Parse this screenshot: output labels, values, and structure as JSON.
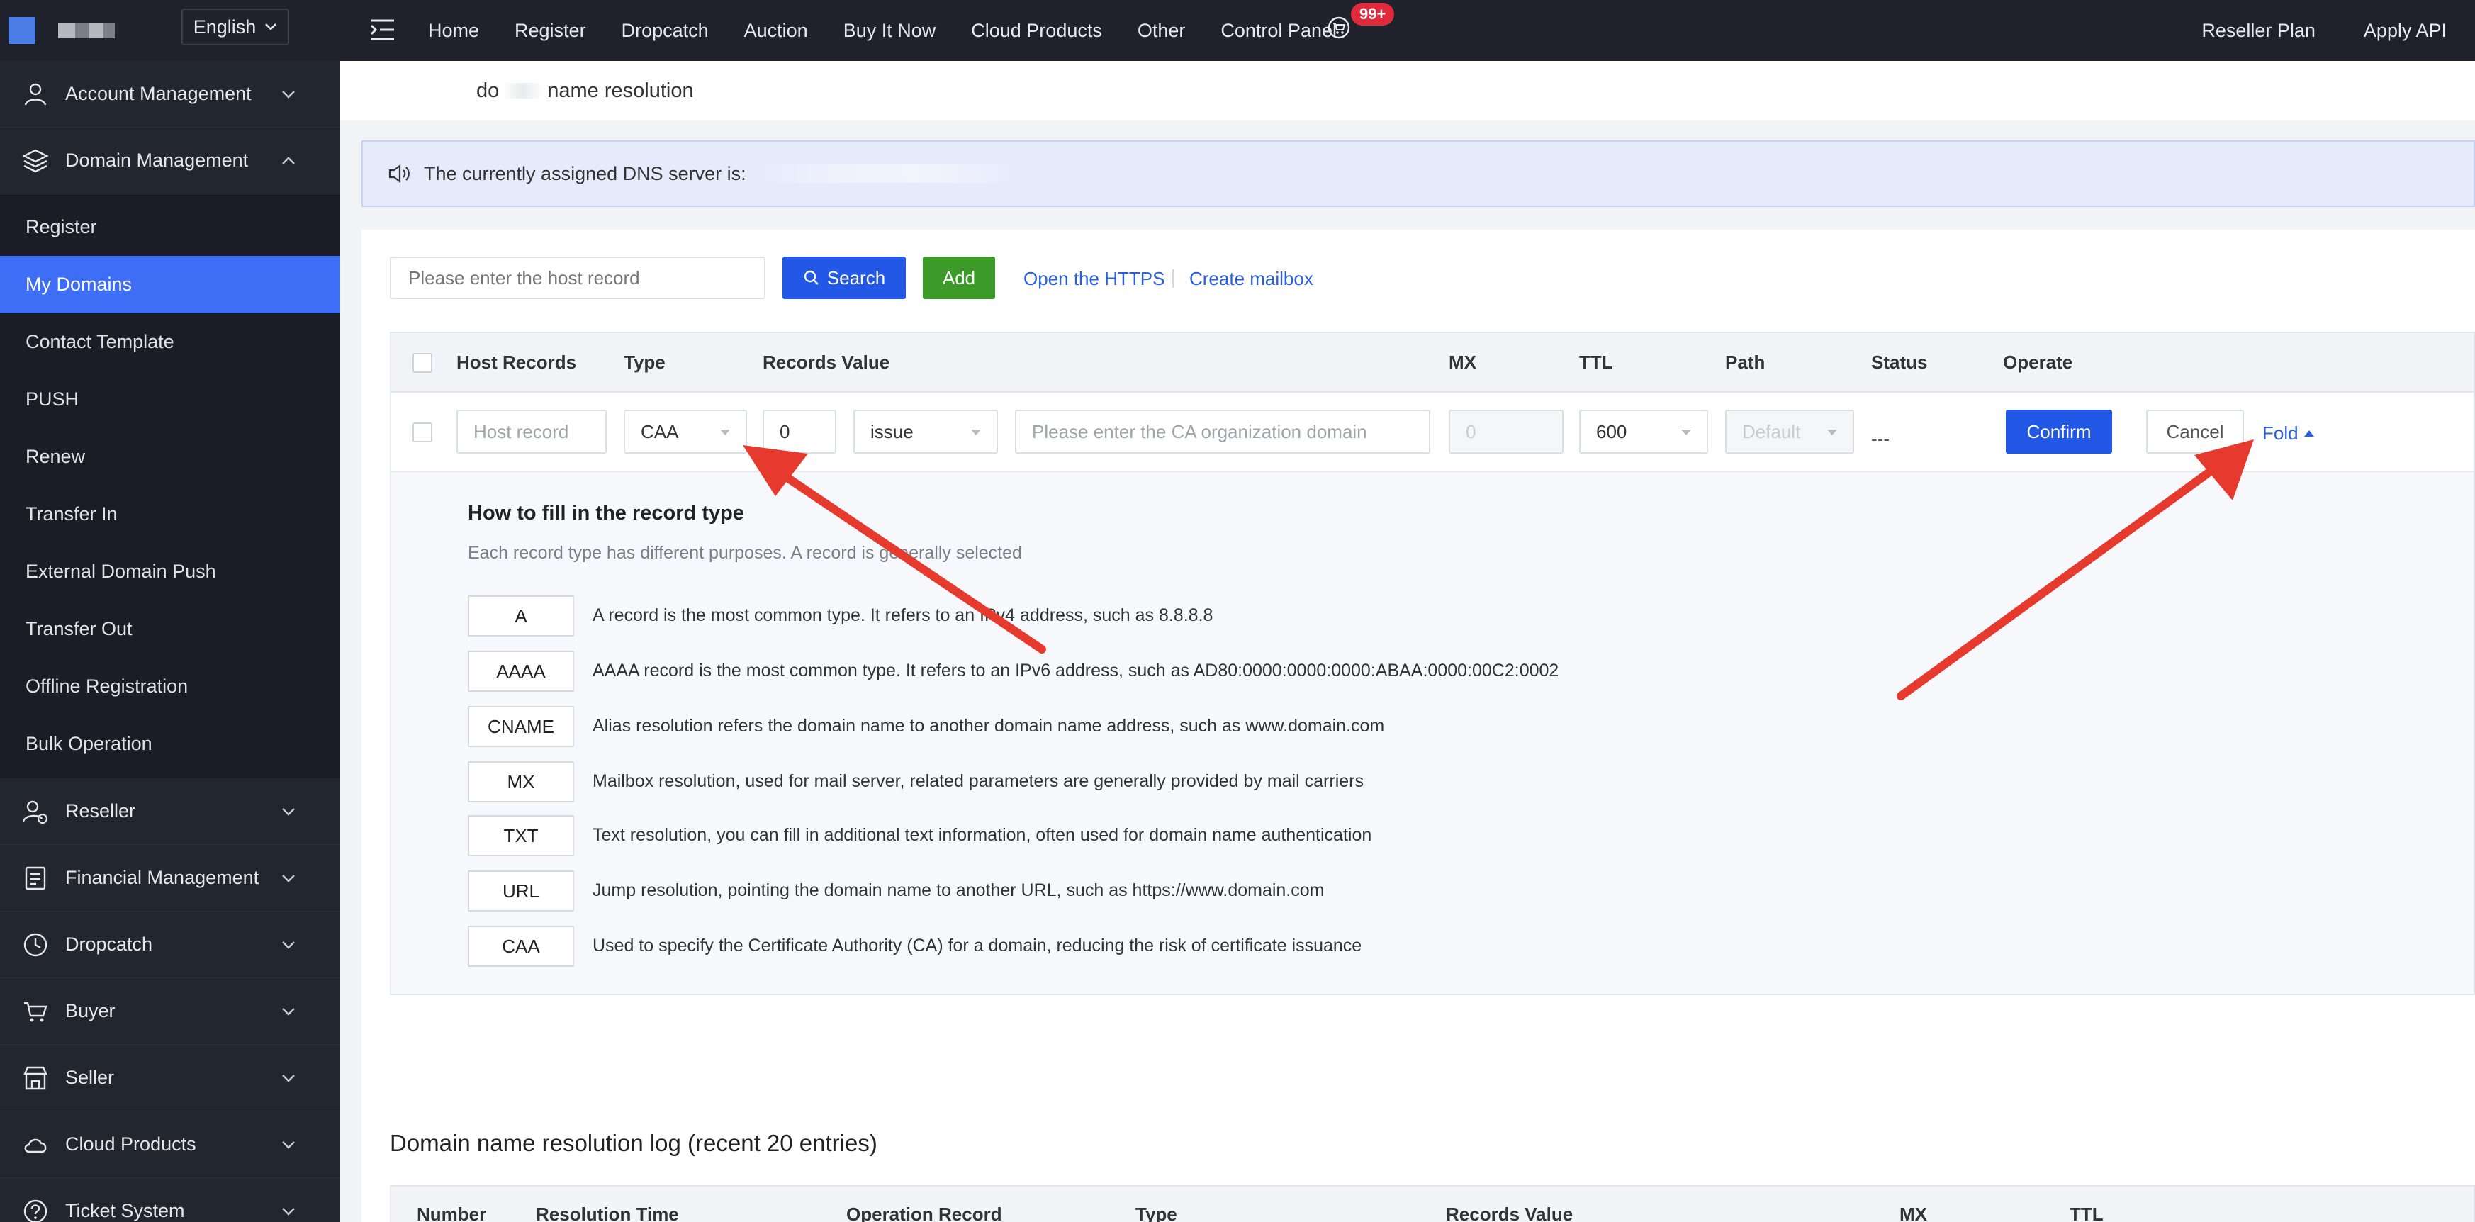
{
  "topbar": {
    "language": "English",
    "nav": [
      "Home",
      "Register",
      "Dropcatch",
      "Auction",
      "Buy It Now",
      "Cloud Products",
      "Other",
      "Control Panel"
    ],
    "cart_badge": "99+",
    "right_links": [
      "Reseller Plan",
      "Apply API"
    ]
  },
  "sidebar": {
    "account": "Account Management",
    "domain": "Domain Management",
    "domain_items": [
      "Register",
      "My Domains",
      "Contact Template",
      "PUSH",
      "Renew",
      "Transfer In",
      "External Domain Push",
      "Transfer Out",
      "Offline Registration",
      "Bulk Operation"
    ],
    "groups": [
      "Reseller",
      "Financial Management",
      "Dropcatch",
      "Buyer",
      "Seller",
      "Cloud Products",
      "Ticket System"
    ]
  },
  "page": {
    "breadcrumb_a": "do",
    "breadcrumb_b": "name resolution",
    "dns_notice": "The currently assigned DNS server is:"
  },
  "toolbar": {
    "search_placeholder": "Please enter the host record",
    "search_label": "Search",
    "add_label": "Add",
    "https_link": "Open the HTTPS",
    "mailbox_link": "Create mailbox"
  },
  "table": {
    "headers": {
      "host": "Host Records",
      "type": "Type",
      "value": "Records Value",
      "mx": "MX",
      "ttl": "TTL",
      "path": "Path",
      "status": "Status",
      "operate": "Operate"
    },
    "edit": {
      "host_placeholder": "Host record",
      "type": "CAA",
      "flag": "0",
      "tag": "issue",
      "value_placeholder": "Please enter the CA organization domain",
      "mx": "0",
      "ttl": "600",
      "path": "Default",
      "status": "---",
      "confirm": "Confirm",
      "cancel": "Cancel",
      "fold": "Fold"
    }
  },
  "help": {
    "title": "How to fill in the record type",
    "subtitle": "Each record type has different purposes. A record is generally selected",
    "types": [
      {
        "tag": "A",
        "desc": "A record is the most common type. It refers to an IPv4 address, such as 8.8.8.8"
      },
      {
        "tag": "AAAA",
        "desc": "AAAA record is the most common type. It refers to an IPv6 address, such as AD80:0000:0000:0000:ABAA:0000:00C2:0002"
      },
      {
        "tag": "CNAME",
        "desc": "Alias resolution refers the domain name to another domain name address, such as www.domain.com"
      },
      {
        "tag": "MX",
        "desc": "Mailbox resolution, used for mail server, related parameters are generally provided by mail carriers"
      },
      {
        "tag": "TXT",
        "desc": "Text resolution, you can fill in additional text information, often used for domain name authentication"
      },
      {
        "tag": "URL",
        "desc": "Jump resolution, pointing the domain name to another URL, such as https://www.domain.com"
      },
      {
        "tag": "CAA",
        "desc": "Used to specify the Certificate Authority (CA) for a domain, reducing the risk of certificate issuance"
      }
    ]
  },
  "log": {
    "title": "Domain name resolution log (recent 20 entries)",
    "headers": [
      "Number",
      "Resolution Time",
      "Operation Record",
      "Type",
      "Records Value",
      "MX",
      "TTL"
    ]
  },
  "colors": {
    "primary": "#2357e6",
    "add_green": "#3b9a28",
    "sidebar_active": "#3d6ef5",
    "annotation_arrow": "#e63a2e"
  }
}
